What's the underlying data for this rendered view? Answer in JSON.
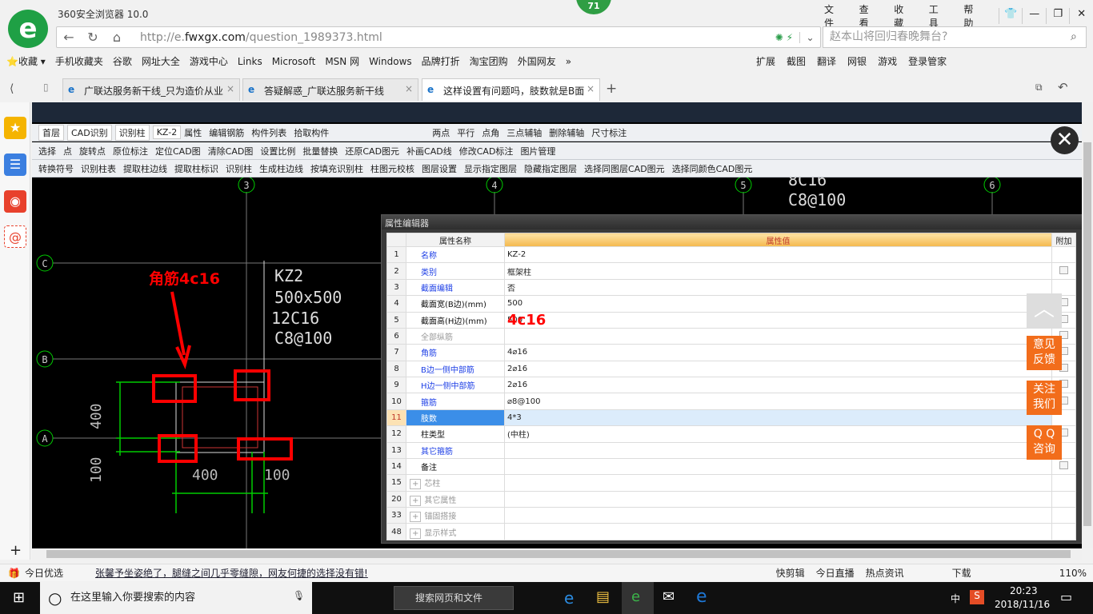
{
  "browser": {
    "title": "360安全浏览器 10.0",
    "badge": "71",
    "menus": [
      "文件",
      "查看",
      "收藏",
      "工具",
      "帮助"
    ],
    "url_prefix": "http://e.",
    "url_domain": "fwxgx.com",
    "url_path": "/question_1989373.html",
    "search_placeholder": "赵本山将回归春晚舞台?",
    "bookmarks": [
      "收藏",
      "手机收藏夹",
      "谷歌",
      "网址大全",
      "游戏中心",
      "Links",
      "Microsoft",
      "MSN 网",
      "Windows",
      "品牌打折",
      "淘宝团购",
      "外国网友"
    ],
    "extensions": [
      "扩展",
      "截图",
      "翻译",
      "网银",
      "游戏",
      "登录管家"
    ],
    "tabs": [
      {
        "label": "广联达服务新干线_只为造价从业"
      },
      {
        "label": "答疑解惑_广联达服务新干线"
      },
      {
        "label": "这样设置有问题吗，肢数就是B面"
      }
    ]
  },
  "toolbar": {
    "row1": {
      "floor": "首层",
      "mode": "CAD识别",
      "type": "识别柱",
      "component": "KZ-2",
      "items": [
        "属性",
        "编辑钢筋",
        "构件列表",
        "拾取构件",
        "两点",
        "平行",
        "点角",
        "三点辅轴",
        "删除辅轴",
        "尺寸标注"
      ]
    },
    "row2": [
      "选择",
      "点",
      "旋转点",
      "原位标注",
      "定位CAD图",
      "清除CAD图",
      "设置比例",
      "批量替换",
      "还原CAD图元",
      "补画CAD线",
      "修改CAD标注",
      "图片管理"
    ],
    "row3": [
      "转换符号",
      "识别柱表",
      "提取柱边线",
      "提取柱标识",
      "识别柱",
      "生成柱边线",
      "按填充识别柱",
      "柱图元校核",
      "图层设置",
      "显示指定图层",
      "隐藏指定图层",
      "选择同图层CAD图元",
      "选择同颜色CAD图元"
    ]
  },
  "cad": {
    "axes_top": [
      "3",
      "4",
      "5",
      "6"
    ],
    "axes_left": [
      "C",
      "B",
      "A"
    ],
    "column_text": [
      "KZ2",
      "500x500",
      "12C16",
      "C8@100"
    ],
    "top_text": [
      "8C16",
      "C8@100"
    ],
    "annotation": "角筋4c16",
    "dims": [
      "400",
      "100",
      "400",
      "100"
    ]
  },
  "property_editor": {
    "title": "属性编辑器",
    "headers": [
      "属性名称",
      "属性值",
      "附加"
    ],
    "rows": [
      {
        "num": "1",
        "name": "名称",
        "value": "KZ-2",
        "style": "blue",
        "check": false
      },
      {
        "num": "2",
        "name": "类别",
        "value": "框架柱",
        "style": "blue",
        "check": true
      },
      {
        "num": "3",
        "name": "截面编辑",
        "value": "否",
        "style": "blue",
        "check": false
      },
      {
        "num": "4",
        "name": "截面宽(B边)(mm)",
        "value": "500",
        "style": "black",
        "check": true
      },
      {
        "num": "5",
        "name": "截面高(H边)(mm)",
        "value": "500",
        "style": "black",
        "check": true
      },
      {
        "num": "6",
        "name": "全部纵筋",
        "value": "",
        "style": "gray",
        "check": true
      },
      {
        "num": "7",
        "name": "角筋",
        "value": "4⌀16",
        "style": "blue",
        "check": true
      },
      {
        "num": "8",
        "name": "B边一侧中部筋",
        "value": "2⌀16",
        "style": "blue",
        "check": true
      },
      {
        "num": "9",
        "name": "H边一侧中部筋",
        "value": "2⌀16",
        "style": "blue",
        "check": true
      },
      {
        "num": "10",
        "name": "箍筋",
        "value": "⌀8@100",
        "style": "blue",
        "check": true
      },
      {
        "num": "11",
        "name": "肢数",
        "value": "4*3",
        "style": "blue",
        "check": false
      },
      {
        "num": "12",
        "name": "柱类型",
        "value": "(中柱)",
        "style": "black",
        "check": true
      },
      {
        "num": "13",
        "name": "其它箍筋",
        "value": "",
        "style": "blue",
        "check": false
      },
      {
        "num": "14",
        "name": "备注",
        "value": "",
        "style": "black",
        "check": true
      },
      {
        "num": "15",
        "name": "芯柱",
        "value": "",
        "style": "gray",
        "check": false
      },
      {
        "num": "20",
        "name": "其它属性",
        "value": "",
        "style": "gray",
        "check": false
      },
      {
        "num": "33",
        "name": "锚固搭接",
        "value": "",
        "style": "gray",
        "check": false
      },
      {
        "num": "48",
        "name": "显示样式",
        "value": "",
        "style": "gray",
        "check": false
      }
    ],
    "selected_row": "11",
    "overlay_label": "4c16"
  },
  "side_buttons": [
    "意见\n反馈",
    "关注\n我们",
    "Q Q\n咨询"
  ],
  "status": {
    "left": "今日优选",
    "news": "张馨予坐姿绝了，腿缝之间几乎零缝隙，网友何捷的选择没有错!",
    "items": [
      "快剪辑",
      "今日直播",
      "热点资讯",
      "下载"
    ],
    "zoom": "110%"
  },
  "taskbar": {
    "search": "在这里输入你要搜索的内容",
    "web_search": "搜索网页和文件",
    "ime": "中",
    "time": "20:23",
    "date": "2018/11/16"
  }
}
